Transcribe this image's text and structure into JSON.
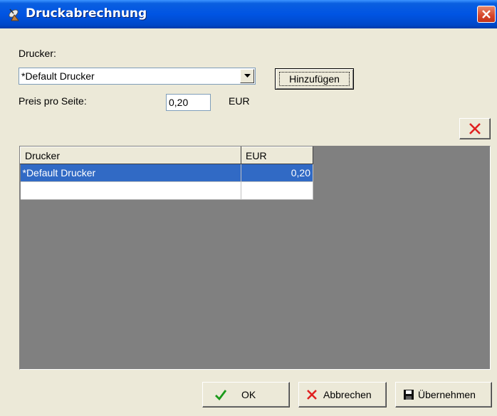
{
  "window": {
    "title": "Druckabrechnung"
  },
  "printer_label": "Drucker:",
  "printer_select": {
    "value": "*Default Drucker"
  },
  "add_button": "Hinzufügen",
  "price_label": "Preis pro Seite:",
  "price_input": {
    "value": "0,20"
  },
  "currency_label": "EUR",
  "table": {
    "columns": [
      "Drucker",
      "EUR"
    ],
    "rows": [
      {
        "printer": "*Default Drucker",
        "eur": "0,20",
        "selected": true
      },
      {
        "printer": "",
        "eur": "",
        "selected": false
      }
    ]
  },
  "buttons": {
    "ok": "OK",
    "cancel": "Abbrechen",
    "apply": "Übernehmen"
  },
  "icons": {
    "title": "satellite-dish-icon",
    "close": "close-icon",
    "delete": "red-x-icon",
    "ok": "green-check-icon",
    "cancel": "red-x-icon",
    "apply": "floppy-disk-icon"
  }
}
